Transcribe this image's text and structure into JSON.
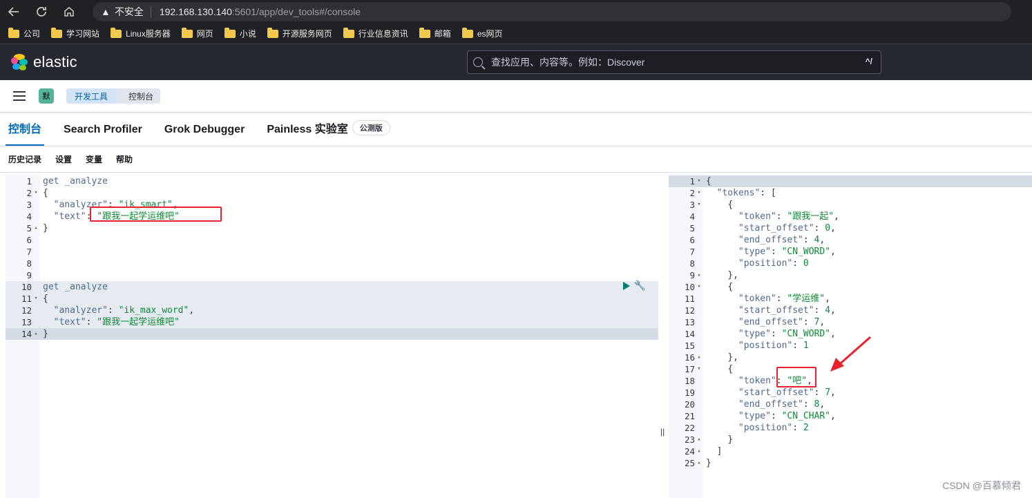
{
  "browser": {
    "insecure_label": "不安全",
    "url_host": "192.168.130.140",
    "url_path": ":5601/app/dev_tools#/console",
    "bookmarks": [
      "公司",
      "学习网站",
      "Linux服务器",
      "网页",
      "小说",
      "开源服务网页",
      "行业信息资讯",
      "邮箱",
      "es网页"
    ]
  },
  "header": {
    "logo_text": "elastic",
    "search_placeholder": "查找应用、内容等。例如：Discover",
    "search_shortcut": "^/"
  },
  "breadcrumb": {
    "space_initial": "默",
    "items": [
      "开发工具",
      "控制台"
    ]
  },
  "tabs": [
    {
      "label": "控制台"
    },
    {
      "label": "Search Profiler"
    },
    {
      "label": "Grok Debugger"
    },
    {
      "label": "Painless 实验室"
    }
  ],
  "beta_badge": "公测版",
  "console_menu": [
    "历史记录",
    "设置",
    "变量",
    "帮助"
  ],
  "left_editor": {
    "lines": [
      {
        "n": "1",
        "fold": "",
        "html": "<span class=\"kw\">get _analyze</span>"
      },
      {
        "n": "2",
        "fold": "▾",
        "html": "<span class=\"punc\">{</span>"
      },
      {
        "n": "3",
        "fold": "",
        "html": "  <span class=\"key\">\"analyzer\"</span><span class=\"punc\">: </span><span class=\"str\">\"ik_smart\"</span><span class=\"punc\">,</span>"
      },
      {
        "n": "4",
        "fold": "",
        "html": "  <span class=\"key\">\"text\"</span><span class=\"punc\">: </span><span class=\"str\">\"跟我一起学运维吧\"</span>"
      },
      {
        "n": "5",
        "fold": "▴",
        "html": "<span class=\"punc\">}</span>"
      },
      {
        "n": "6",
        "fold": "",
        "html": ""
      },
      {
        "n": "7",
        "fold": "",
        "html": ""
      },
      {
        "n": "8",
        "fold": "",
        "html": ""
      },
      {
        "n": "9",
        "fold": "",
        "html": ""
      },
      {
        "n": "10",
        "fold": "",
        "html": "<span class=\"kw\">get _analyze</span>"
      },
      {
        "n": "11",
        "fold": "▾",
        "html": "<span class=\"punc\">{</span>"
      },
      {
        "n": "12",
        "fold": "",
        "html": "  <span class=\"key\">\"analyzer\"</span><span class=\"punc\">: </span><span class=\"str\">\"ik_max_word\"</span><span class=\"punc\">,</span>"
      },
      {
        "n": "13",
        "fold": "",
        "html": "  <span class=\"key\">\"text\"</span><span class=\"punc\">: </span><span class=\"str\">\"跟我一起学运维吧\"</span>"
      },
      {
        "n": "14",
        "fold": "▴",
        "html": "<span class=\"punc\">}</span>"
      }
    ]
  },
  "right_editor": {
    "lines": [
      {
        "n": "1",
        "fold": "▾",
        "html": "<span class=\"punc\">{</span>"
      },
      {
        "n": "2",
        "fold": "▾",
        "html": "  <span class=\"key\">\"tokens\"</span><span class=\"punc\">: [</span>"
      },
      {
        "n": "3",
        "fold": "▾",
        "html": "    <span class=\"punc\">{</span>"
      },
      {
        "n": "4",
        "fold": "",
        "html": "      <span class=\"key\">\"token\"</span><span class=\"punc\">: </span><span class=\"str\">\"跟我一起\"</span><span class=\"punc\">,</span>"
      },
      {
        "n": "5",
        "fold": "",
        "html": "      <span class=\"key\">\"start_offset\"</span><span class=\"punc\">: </span><span class=\"num\">0</span><span class=\"punc\">,</span>"
      },
      {
        "n": "6",
        "fold": "",
        "html": "      <span class=\"key\">\"end_offset\"</span><span class=\"punc\">: </span><span class=\"num\">4</span><span class=\"punc\">,</span>"
      },
      {
        "n": "7",
        "fold": "",
        "html": "      <span class=\"key\">\"type\"</span><span class=\"punc\">: </span><span class=\"str\">\"CN_WORD\"</span><span class=\"punc\">,</span>"
      },
      {
        "n": "8",
        "fold": "",
        "html": "      <span class=\"key\">\"position\"</span><span class=\"punc\">: </span><span class=\"num\">0</span>"
      },
      {
        "n": "9",
        "fold": "▴",
        "html": "    <span class=\"punc\">},</span>"
      },
      {
        "n": "10",
        "fold": "▾",
        "html": "    <span class=\"punc\">{</span>"
      },
      {
        "n": "11",
        "fold": "",
        "html": "      <span class=\"key\">\"token\"</span><span class=\"punc\">: </span><span class=\"str\">\"学运维\"</span><span class=\"punc\">,</span>"
      },
      {
        "n": "12",
        "fold": "",
        "html": "      <span class=\"key\">\"start_offset\"</span><span class=\"punc\">: </span><span class=\"num\">4</span><span class=\"punc\">,</span>"
      },
      {
        "n": "13",
        "fold": "",
        "html": "      <span class=\"key\">\"end_offset\"</span><span class=\"punc\">: </span><span class=\"num\">7</span><span class=\"punc\">,</span>"
      },
      {
        "n": "14",
        "fold": "",
        "html": "      <span class=\"key\">\"type\"</span><span class=\"punc\">: </span><span class=\"str\">\"CN_WORD\"</span><span class=\"punc\">,</span>"
      },
      {
        "n": "15",
        "fold": "",
        "html": "      <span class=\"key\">\"position\"</span><span class=\"punc\">: </span><span class=\"num\">1</span>"
      },
      {
        "n": "16",
        "fold": "▴",
        "html": "    <span class=\"punc\">},</span>"
      },
      {
        "n": "17",
        "fold": "▾",
        "html": "    <span class=\"punc\">{</span>"
      },
      {
        "n": "18",
        "fold": "",
        "html": "      <span class=\"key\">\"token\"</span><span class=\"punc\">: </span><span class=\"str\">\"吧\"</span><span class=\"punc\">,</span>"
      },
      {
        "n": "19",
        "fold": "",
        "html": "      <span class=\"key\">\"start_offset\"</span><span class=\"punc\">: </span><span class=\"num\">7</span><span class=\"punc\">,</span>"
      },
      {
        "n": "20",
        "fold": "",
        "html": "      <span class=\"key\">\"end_offset\"</span><span class=\"punc\">: </span><span class=\"num\">8</span><span class=\"punc\">,</span>"
      },
      {
        "n": "21",
        "fold": "",
        "html": "      <span class=\"key\">\"type\"</span><span class=\"punc\">: </span><span class=\"str\">\"CN_CHAR\"</span><span class=\"punc\">,</span>"
      },
      {
        "n": "22",
        "fold": "",
        "html": "      <span class=\"key\">\"position\"</span><span class=\"punc\">: </span><span class=\"num\">2</span>"
      },
      {
        "n": "23",
        "fold": "▴",
        "html": "    <span class=\"punc\">}</span>"
      },
      {
        "n": "24",
        "fold": "▴",
        "html": "  <span class=\"punc\">]</span>"
      },
      {
        "n": "25",
        "fold": "▴",
        "html": "<span class=\"punc\">}</span>"
      }
    ]
  },
  "watermark": "CSDN @百慕倾君",
  "colors": {
    "accent": "#006bb8",
    "annotation": "#e8222a"
  }
}
